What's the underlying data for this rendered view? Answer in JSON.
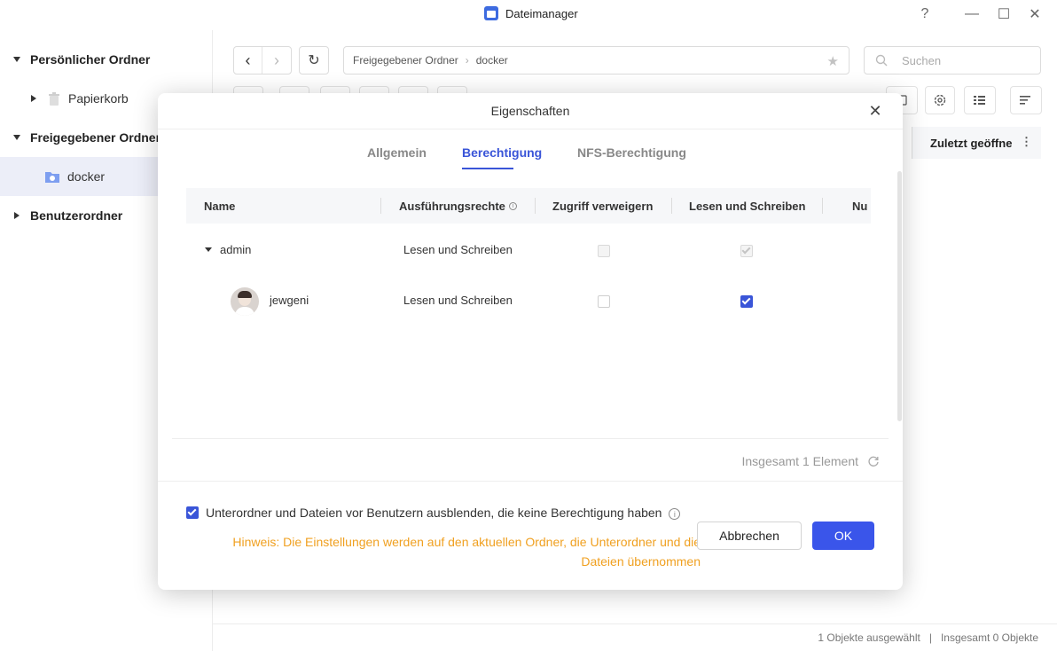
{
  "app": {
    "title": "Dateimanager"
  },
  "window": {
    "help": "?",
    "minimize": "—",
    "maximize": "☐",
    "close": "✕"
  },
  "sidebar": {
    "personal": "Persönlicher Ordner",
    "trash": "Papierkorb",
    "shared": "Freigegebener Ordner",
    "docker": "docker",
    "user_folders": "Benutzerordner"
  },
  "toolbar": {
    "back": "‹",
    "forward": "›",
    "refresh": "↻",
    "path_root": "Freigegebener Ordner",
    "path_sep": "›",
    "path_current": "docker",
    "star": "★",
    "search_placeholder": "Suchen",
    "column_recent": "Zuletzt geöffne",
    "more": "⋮"
  },
  "status": {
    "selected": "1 Objekte ausgewählt",
    "sep": "|",
    "total": "Insgesamt 0 Objekte"
  },
  "dialog": {
    "title": "Eigenschaften",
    "close": "✕",
    "tabs": [
      "Allgemein",
      "Berechtigung",
      "NFS-Berechtigung"
    ],
    "active_tab": "Berechtigung",
    "columns": {
      "name": "Name",
      "exec": "Ausführungsrechte",
      "deny": "Zugriff verweigern",
      "rw": "Lesen und Schreiben",
      "ro": "Nu"
    },
    "rows": [
      {
        "name": "admin",
        "exec": "Lesen und Schreiben",
        "deny": false,
        "rw": true,
        "disabled": true
      },
      {
        "name": "jewgeni",
        "exec": "Lesen und Schreiben",
        "deny": false,
        "rw": true,
        "disabled": false
      }
    ],
    "total": "Insgesamt 1 Element",
    "hide_label": "Unterordner und Dateien vor Benutzern ausblenden, die keine Berechtigung haben",
    "hide_checked": true,
    "hint_line1": "Hinweis: Die Einstellungen werden auf den aktuellen Ordner, die Unterordner und die",
    "hint_line2": "Dateien übernommen",
    "cancel": "Abbrechen",
    "ok": "OK"
  },
  "colors": {
    "accent": "#3a55d8",
    "warning": "#f0a020",
    "ok_button": "#3a55ea"
  }
}
